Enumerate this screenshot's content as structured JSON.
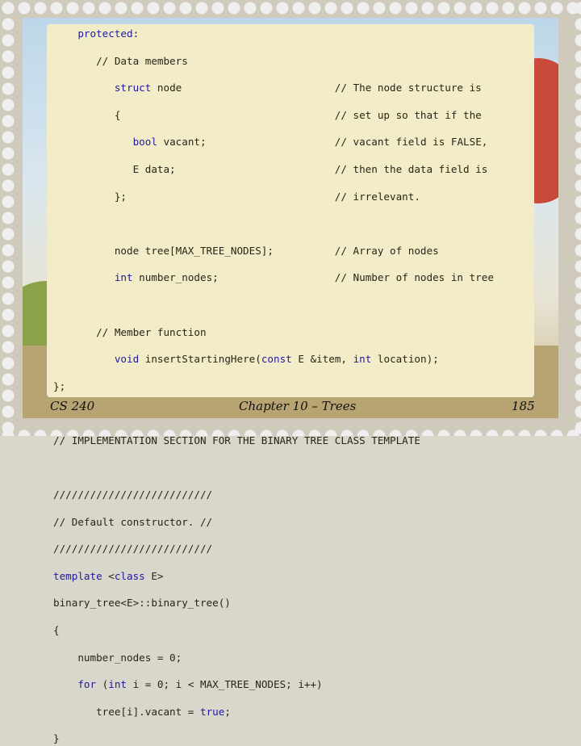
{
  "code": {
    "lines": [
      "    protected:",
      "       // Data members",
      "          struct node                         // The node structure is",
      "          {                                   // set up so that if the",
      "             bool vacant;                     // vacant field is FALSE,",
      "             E data;                          // then the data field is",
      "          };                                  // irrelevant.",
      "",
      "          node tree[MAX_TREE_NODES];          // Array of nodes",
      "          int number_nodes;                   // Number of nodes in tree",
      "",
      "       // Member function",
      "          void insertStartingHere(const E &item, int location);",
      "};",
      "",
      "// IMPLEMENTATION SECTION FOR THE BINARY TREE CLASS TEMPLATE",
      "",
      "//////////////////////////",
      "// Default constructor. //",
      "//////////////////////////",
      "template <class E>",
      "binary_tree<E>::binary_tree()",
      "{",
      "    number_nodes = 0;",
      "    for (int i = 0; i < MAX_TREE_NODES; i++)",
      "       tree[i].vacant = true;",
      "}"
    ]
  },
  "footer": {
    "course": "CS 240",
    "chapter": "Chapter 10 – Trees",
    "page": "185"
  },
  "colors": {
    "keyword": "#1f1a9c",
    "panel": "#f3ecc9"
  }
}
